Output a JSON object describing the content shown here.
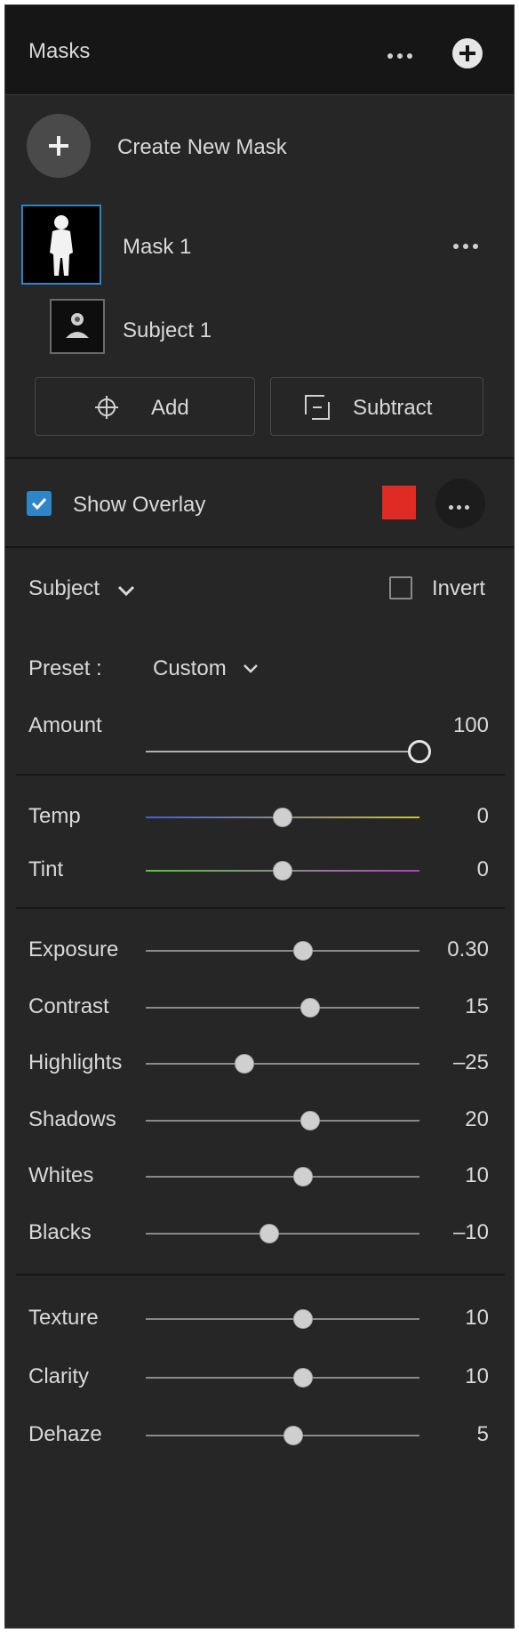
{
  "header": {
    "title": "Masks"
  },
  "create_mask": {
    "label": "Create New Mask"
  },
  "mask1": {
    "label": "Mask 1"
  },
  "subject1": {
    "label": "Subject 1"
  },
  "actions": {
    "add_label": "Add",
    "subtract_label": "Subtract"
  },
  "overlay": {
    "label": "Show Overlay",
    "checked": true,
    "color": "#e02a24"
  },
  "subject_section": {
    "title": "Subject",
    "invert_label": "Invert",
    "invert_checked": false
  },
  "preset": {
    "label": "Preset :",
    "value": "Custom"
  },
  "amount": {
    "label": "Amount",
    "value": "100",
    "fraction": 1.0
  },
  "color_group": [
    {
      "key": "temp",
      "label": "Temp",
      "value": "0",
      "fraction": 0.5
    },
    {
      "key": "tint",
      "label": "Tint",
      "value": "0",
      "fraction": 0.5
    }
  ],
  "tone_group": [
    {
      "key": "exposure",
      "label": "Exposure",
      "value": "0.30",
      "fraction": 0.575
    },
    {
      "key": "contrast",
      "label": "Contrast",
      "value": "15",
      "fraction": 0.6
    },
    {
      "key": "highlights",
      "label": "Highlights",
      "value": "–25",
      "fraction": 0.36
    },
    {
      "key": "shadows",
      "label": "Shadows",
      "value": "20",
      "fraction": 0.6
    },
    {
      "key": "whites",
      "label": "Whites",
      "value": "10",
      "fraction": 0.575
    },
    {
      "key": "blacks",
      "label": "Blacks",
      "value": "–10",
      "fraction": 0.45
    }
  ],
  "presence_group": [
    {
      "key": "texture",
      "label": "Texture",
      "value": "10",
      "fraction": 0.575
    },
    {
      "key": "clarity",
      "label": "Clarity",
      "value": "10",
      "fraction": 0.575
    },
    {
      "key": "dehaze",
      "label": "Dehaze",
      "value": "5",
      "fraction": 0.54
    }
  ]
}
